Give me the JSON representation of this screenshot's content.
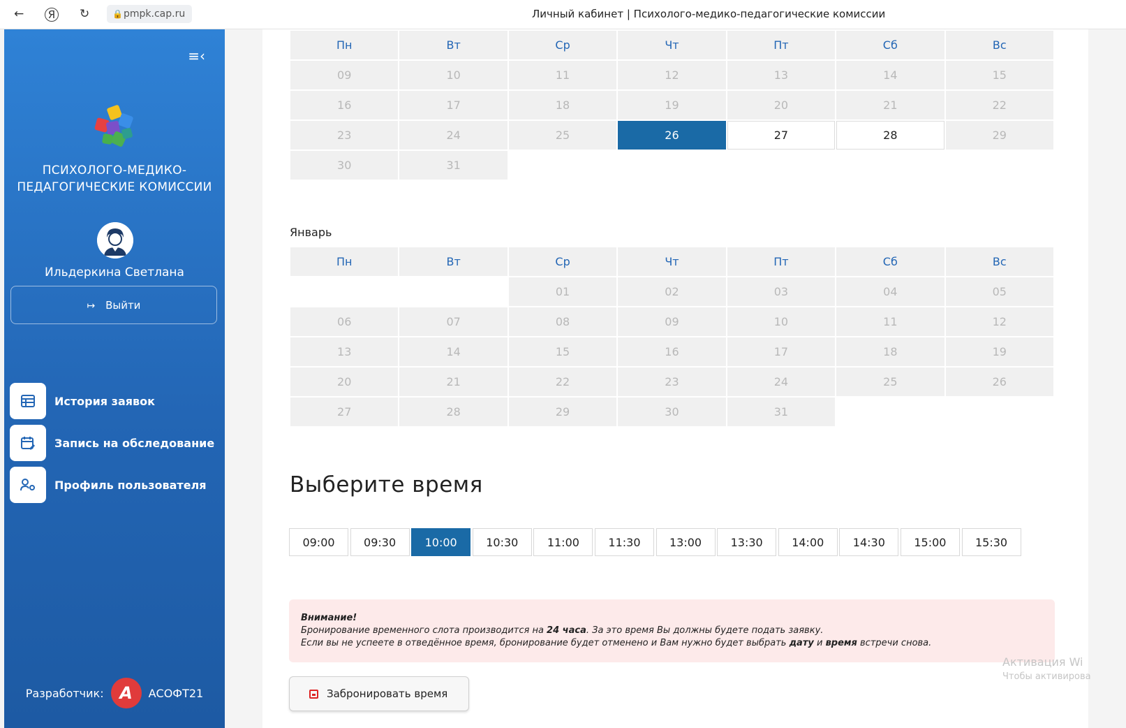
{
  "browser": {
    "back_icon": "←",
    "yandex_icon": "Я",
    "reload_icon": "↻",
    "url": "pmpk.cap.ru",
    "tab_title": "Личный кабинет | Психолого-медико-педагогические комиссии"
  },
  "sidebar": {
    "collapse_icon": "≡‹",
    "org_line1": "ПСИХОЛОГО-МЕДИКО-",
    "org_line2": "ПЕДАГОГИЧЕСКИЕ КОМИССИИ",
    "user_name": "Ильдеркина Светлана",
    "logout_icon": "↦",
    "logout_label": "Выйти",
    "menu": [
      {
        "label": "История заявок",
        "icon": "table-icon"
      },
      {
        "label": "Запись на обследование",
        "icon": "calendar-edit-icon"
      },
      {
        "label": "Профиль пользователя",
        "icon": "user-settings-icon"
      }
    ],
    "developer_label": "Разработчик:",
    "developer_name": "АСОФТ21",
    "developer_badge": "A"
  },
  "weekdays": [
    "Пн",
    "Вт",
    "Ср",
    "Чт",
    "Пт",
    "Сб",
    "Вс"
  ],
  "december": {
    "rows": [
      [
        "09",
        "10",
        "11",
        "12",
        "13",
        "14",
        "15"
      ],
      [
        "16",
        "17",
        "18",
        "19",
        "20",
        "21",
        "22"
      ],
      [
        "23",
        "24",
        "25",
        "26",
        "27",
        "28",
        "29"
      ],
      [
        "30",
        "31",
        "",
        "",
        "",
        "",
        ""
      ]
    ],
    "selected": "26",
    "available": [
      "27",
      "28"
    ]
  },
  "january": {
    "label": "Январь",
    "rows": [
      [
        "",
        "",
        "01",
        "02",
        "03",
        "04",
        "05"
      ],
      [
        "06",
        "07",
        "08",
        "09",
        "10",
        "11",
        "12"
      ],
      [
        "13",
        "14",
        "15",
        "16",
        "17",
        "18",
        "19"
      ],
      [
        "20",
        "21",
        "22",
        "23",
        "24",
        "25",
        "26"
      ],
      [
        "27",
        "28",
        "29",
        "30",
        "31",
        "",
        ""
      ]
    ]
  },
  "time": {
    "title": "Выберите время",
    "slots": [
      "09:00",
      "09:30",
      "10:00",
      "10:30",
      "11:00",
      "11:30",
      "13:00",
      "13:30",
      "14:00",
      "14:30",
      "15:00",
      "15:30"
    ],
    "selected": "10:00"
  },
  "alert": {
    "title": "Внимание!",
    "l1_a": "Бронирование временного слота производится на ",
    "l1_b": "24 часа",
    "l1_c": ". За это время Вы должны будете подать заявку.",
    "l2_a": "Если вы не успеете в отведённое время, бронирование будет отменено и Вам нужно будет выбрать ",
    "l2_b": "дату",
    "l2_c": " и ",
    "l2_d": "время",
    "l2_e": " встречи снова."
  },
  "watermark": {
    "line1": "Активация Wi",
    "line2": "Чтобы активирова"
  },
  "book_button": "Забронировать время"
}
